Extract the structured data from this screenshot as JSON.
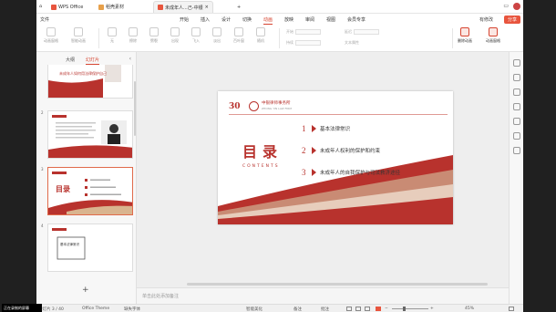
{
  "titlebar": {
    "app_tab": "WPS Office",
    "template_tab": "稻壳素材",
    "doc_tab": "未成年人...己-中银",
    "new_tab": "+"
  },
  "menubar": {
    "file": "文件",
    "items": [
      "开始",
      "插入",
      "设计",
      "切换",
      "动画",
      "放映",
      "审阅",
      "视图",
      "会员专享"
    ],
    "active_index": 4,
    "sync": "有修改",
    "share": "分享"
  },
  "ribbon": {
    "left": [
      {
        "label": "动画窗格",
        "active": false
      },
      {
        "label": "智能动画",
        "active": false
      }
    ],
    "effects": [
      "无",
      "擦除",
      "劈裂",
      "出现",
      "飞入",
      "淡出",
      "百叶窗",
      "随机"
    ],
    "options": [
      "开始",
      "持续",
      "延迟",
      "文本属性"
    ],
    "right": [
      {
        "label": "删除动画",
        "active": true
      },
      {
        "label": "动画窗格",
        "active": true
      }
    ]
  },
  "panel": {
    "tabs": [
      "大纲",
      "幻灯片"
    ],
    "active_tab": 1,
    "collapse": "‹",
    "slides": [
      {
        "num": "",
        "title": "未成年人如何用法律保护自己"
      },
      {
        "num": "2",
        "title": ""
      },
      {
        "num": "3",
        "title": "目录"
      },
      {
        "num": "4",
        "title": "基本法律常识"
      }
    ],
    "add": "+"
  },
  "slide": {
    "badge": "30",
    "firm_name": "中银律师事务所",
    "firm_sub": "ZHONG YIN LAW FIRM",
    "title": "目录",
    "contents": "CONTENTS",
    "toc": [
      {
        "num": "1",
        "text": "基本法律常识"
      },
      {
        "num": "2",
        "text": "未成年人权利的保护和约束"
      },
      {
        "num": "3",
        "text": "未成年人的自我保护与司法救济途径"
      }
    ]
  },
  "notes": {
    "placeholder": "单击此处添加备注"
  },
  "status": {
    "slide_pos": "幻灯片 3 / 40",
    "theme": "Office Theme",
    "font_missing": "缺失字体",
    "beautify": "智能美化",
    "notes": "备注",
    "comments": "批注",
    "zoom": "45%"
  },
  "recorder": {
    "label": "正在录制的屏幕"
  },
  "colors": {
    "accent": "#d64531",
    "brand_red": "#b8322d",
    "share": "#e8553e"
  }
}
